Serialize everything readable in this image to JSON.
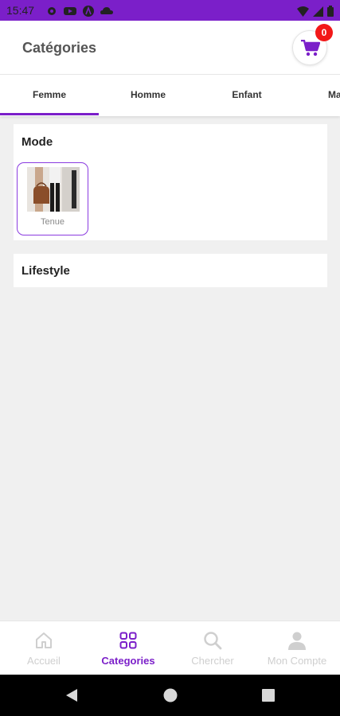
{
  "status_bar": {
    "time": "15:47",
    "icons": [
      "settings-icon",
      "youtube-icon",
      "app-a-icon",
      "cloud-icon",
      "wifi-icon",
      "signal-icon",
      "battery-icon"
    ]
  },
  "header": {
    "title": "Catégories",
    "cart_count": "0"
  },
  "tabs": [
    {
      "label": "Femme",
      "active": true
    },
    {
      "label": "Homme",
      "active": false
    },
    {
      "label": "Enfant",
      "active": false
    },
    {
      "label": "Ma",
      "active": false
    }
  ],
  "sections": [
    {
      "title": "Mode",
      "items": [
        {
          "label": "Tenue"
        }
      ]
    },
    {
      "title": "Lifestyle",
      "items": []
    }
  ],
  "bottom_nav": [
    {
      "label": "Accueil",
      "icon": "home-icon",
      "active": false
    },
    {
      "label": "Categories",
      "icon": "categories-icon",
      "active": true
    },
    {
      "label": "Chercher",
      "icon": "search-icon",
      "active": false
    },
    {
      "label": "Mon Compte",
      "icon": "account-icon",
      "active": false
    }
  ],
  "colors": {
    "accent": "#7b1fc9",
    "badge": "#f21818",
    "inactive": "#cfcfcf",
    "background": "#f0f0f0"
  }
}
